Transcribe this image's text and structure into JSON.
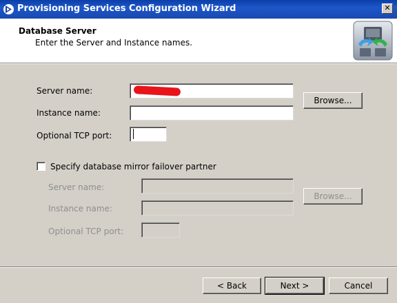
{
  "window": {
    "title": "Provisioning Services Configuration Wizard",
    "close_glyph": "✕"
  },
  "header": {
    "title": "Database Server",
    "subtitle": "Enter the Server and Instance names."
  },
  "primary": {
    "server_name_label": "Server name:",
    "server_name_value": "",
    "instance_name_label": "Instance name:",
    "instance_name_value": "",
    "tcp_port_label": "Optional TCP port:",
    "tcp_port_value": "",
    "browse_label": "Browse..."
  },
  "mirror": {
    "checkbox_label": "Specify database mirror failover partner",
    "checked": false,
    "server_name_label": "Server name:",
    "instance_name_label": "Instance name:",
    "tcp_port_label": "Optional TCP port:",
    "browse_label": "Browse..."
  },
  "footer": {
    "back_label": "< Back",
    "next_label": "Next >",
    "cancel_label": "Cancel"
  },
  "colors": {
    "title_bar": "#1c57c9",
    "dialog_bg": "#d4d0c8",
    "redaction": "#e8141b"
  }
}
